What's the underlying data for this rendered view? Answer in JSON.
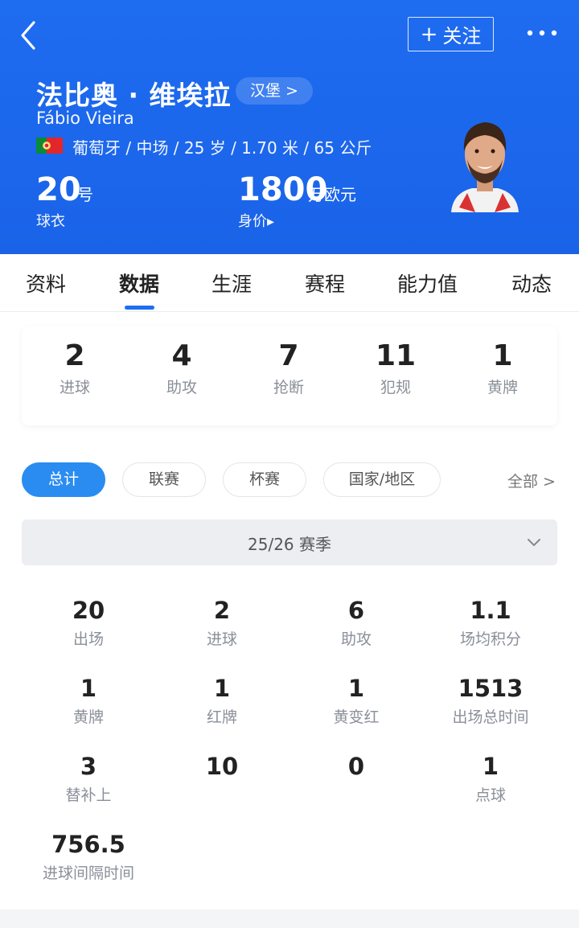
{
  "header": {
    "follow_label": "关注",
    "follow_plus": "+",
    "name_cn": "法比奥 · 维埃拉",
    "club": "汉堡 >",
    "name_en": "Fábio Vieira",
    "info": "葡萄牙 / 中场 / 25 岁 / 1.70 米 / 65 公斤",
    "shirt_number": "20",
    "shirt_unit": "号",
    "shirt_label": "球衣",
    "value": "1800",
    "value_unit": "万欧元",
    "value_label": "身价▸",
    "colors": {
      "bg": "#1e6cf0",
      "accent": "#2a8cf0"
    }
  },
  "tabs": [
    "资料",
    "数据",
    "生涯",
    "赛程",
    "能力值",
    "动态"
  ],
  "active_tab": "数据",
  "summary": [
    {
      "value": "2",
      "label": "进球"
    },
    {
      "value": "4",
      "label": "助攻"
    },
    {
      "value": "7",
      "label": "抢断"
    },
    {
      "value": "11",
      "label": "犯规"
    },
    {
      "value": "1",
      "label": "黄牌"
    }
  ],
  "filters": [
    "总计",
    "联赛",
    "杯赛",
    "国家/地区"
  ],
  "active_filter": "总计",
  "filter_all": "全部 >",
  "season": "25/26 赛季",
  "stats": [
    {
      "value": "20",
      "label": "出场"
    },
    {
      "value": "2",
      "label": "进球"
    },
    {
      "value": "6",
      "label": "助攻"
    },
    {
      "value": "1.1",
      "label": "场均积分"
    },
    {
      "value": "1",
      "label": "黄牌"
    },
    {
      "value": "1",
      "label": "红牌"
    },
    {
      "value": "1",
      "label": "黄变红"
    },
    {
      "value": "1513",
      "label": "出场总时间"
    },
    {
      "value": "3",
      "label": "替补上"
    },
    {
      "value": "10",
      "label": ""
    },
    {
      "value": "0",
      "label": ""
    },
    {
      "value": "1",
      "label": "点球"
    },
    {
      "value": "756.5",
      "label": "进球间隔时间"
    }
  ]
}
